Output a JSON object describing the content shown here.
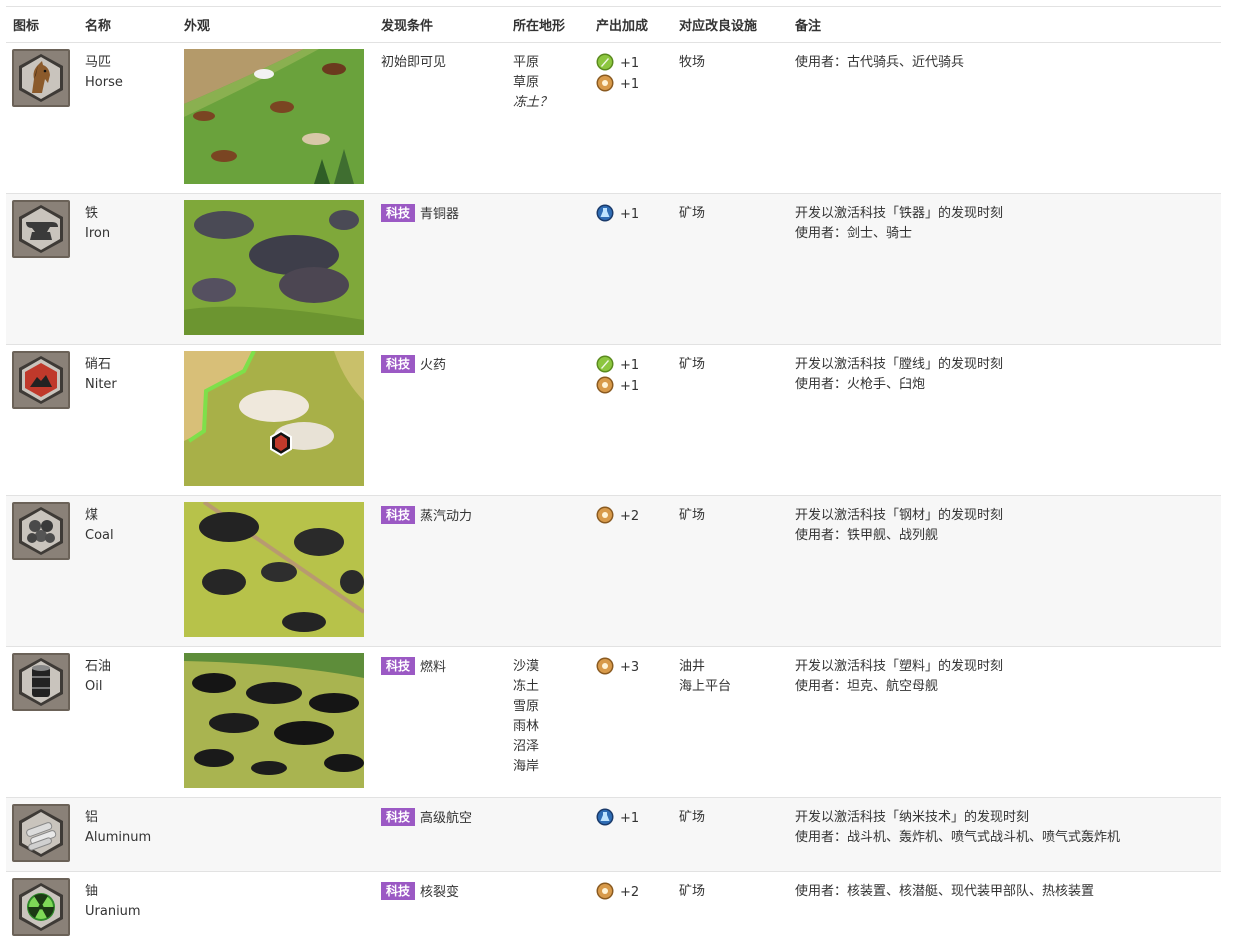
{
  "headers": [
    "图标",
    "名称",
    "外观",
    "发现条件",
    "所在地形",
    "产出加成",
    "对应改良设施",
    "备注"
  ],
  "tech_tag": "科技",
  "colors": {
    "tag": "#9b59c4",
    "row_alt": "#f7f7f7",
    "border": "#e2e2e2"
  },
  "rows": [
    {
      "icon": "horse-icon",
      "name_cn": "马匹",
      "name_en": "Horse",
      "appearance": "horses-on-grassland",
      "discovery": "初始即可见",
      "terrain": [
        "平原",
        "草原",
        "冻土？"
      ],
      "yields": [
        {
          "type": "production-icon",
          "value": "+1"
        },
        {
          "type": "food-icon",
          "value": "+1"
        }
      ],
      "improvements": [
        "牧场"
      ],
      "notes": [
        "使用者：古代骑兵、近代骑兵"
      ]
    },
    {
      "icon": "anvil-icon",
      "name_cn": "铁",
      "name_en": "Iron",
      "appearance": "iron-deposits",
      "discovery": "青铜器",
      "terrain": [],
      "yields": [
        {
          "type": "science-icon",
          "value": "+1"
        }
      ],
      "improvements": [
        "矿场"
      ],
      "notes": [
        "开发以激活科技「铁器」的发现时刻",
        "使用者：剑士、骑士"
      ]
    },
    {
      "icon": "niter-icon",
      "name_cn": "硝石",
      "name_en": "Niter",
      "appearance": "niter-deposits",
      "discovery": "火药",
      "terrain": [],
      "yields": [
        {
          "type": "production-icon",
          "value": "+1"
        },
        {
          "type": "food-icon",
          "value": "+1"
        }
      ],
      "improvements": [
        "矿场"
      ],
      "notes": [
        "开发以激活科技「膛线」的发现时刻",
        "使用者：火枪手、臼炮"
      ]
    },
    {
      "icon": "coal-icon",
      "name_cn": "煤",
      "name_en": "Coal",
      "appearance": "coal-deposits",
      "discovery": "蒸汽动力",
      "terrain": [],
      "yields": [
        {
          "type": "food-icon",
          "value": "+2"
        }
      ],
      "improvements": [
        "矿场"
      ],
      "notes": [
        "开发以激活科技「钢材」的发现时刻",
        "使用者：铁甲舰、战列舰"
      ]
    },
    {
      "icon": "oil-barrel-icon",
      "name_cn": "石油",
      "name_en": "Oil",
      "appearance": "oil-deposits",
      "discovery": "燃料",
      "terrain": [
        "沙漠",
        "冻土",
        "雪原",
        "雨林",
        "沼泽",
        "海岸"
      ],
      "yields": [
        {
          "type": "food-icon",
          "value": "+3"
        }
      ],
      "improvements": [
        "油井",
        "海上平台"
      ],
      "notes": [
        "开发以激活科技「塑料」的发现时刻",
        "使用者：坦克、航空母舰"
      ]
    },
    {
      "icon": "aluminum-icon",
      "name_cn": "铝",
      "name_en": "Aluminum",
      "appearance": "",
      "discovery": "高级航空",
      "terrain": [],
      "yields": [
        {
          "type": "science-icon",
          "value": "+1"
        }
      ],
      "improvements": [
        "矿场"
      ],
      "notes": [
        "开发以激活科技「纳米技术」的发现时刻",
        "使用者：战斗机、轰炸机、喷气式战斗机、喷气式轰炸机"
      ]
    },
    {
      "icon": "uranium-icon",
      "name_cn": "铀",
      "name_en": "Uranium",
      "appearance": "",
      "discovery": "核裂变",
      "terrain": [],
      "yields": [
        {
          "type": "food-icon",
          "value": "+2"
        }
      ],
      "improvements": [
        "矿场"
      ],
      "notes": [
        "使用者：核装置、核潜艇、现代装甲部队、热核装置"
      ]
    }
  ]
}
